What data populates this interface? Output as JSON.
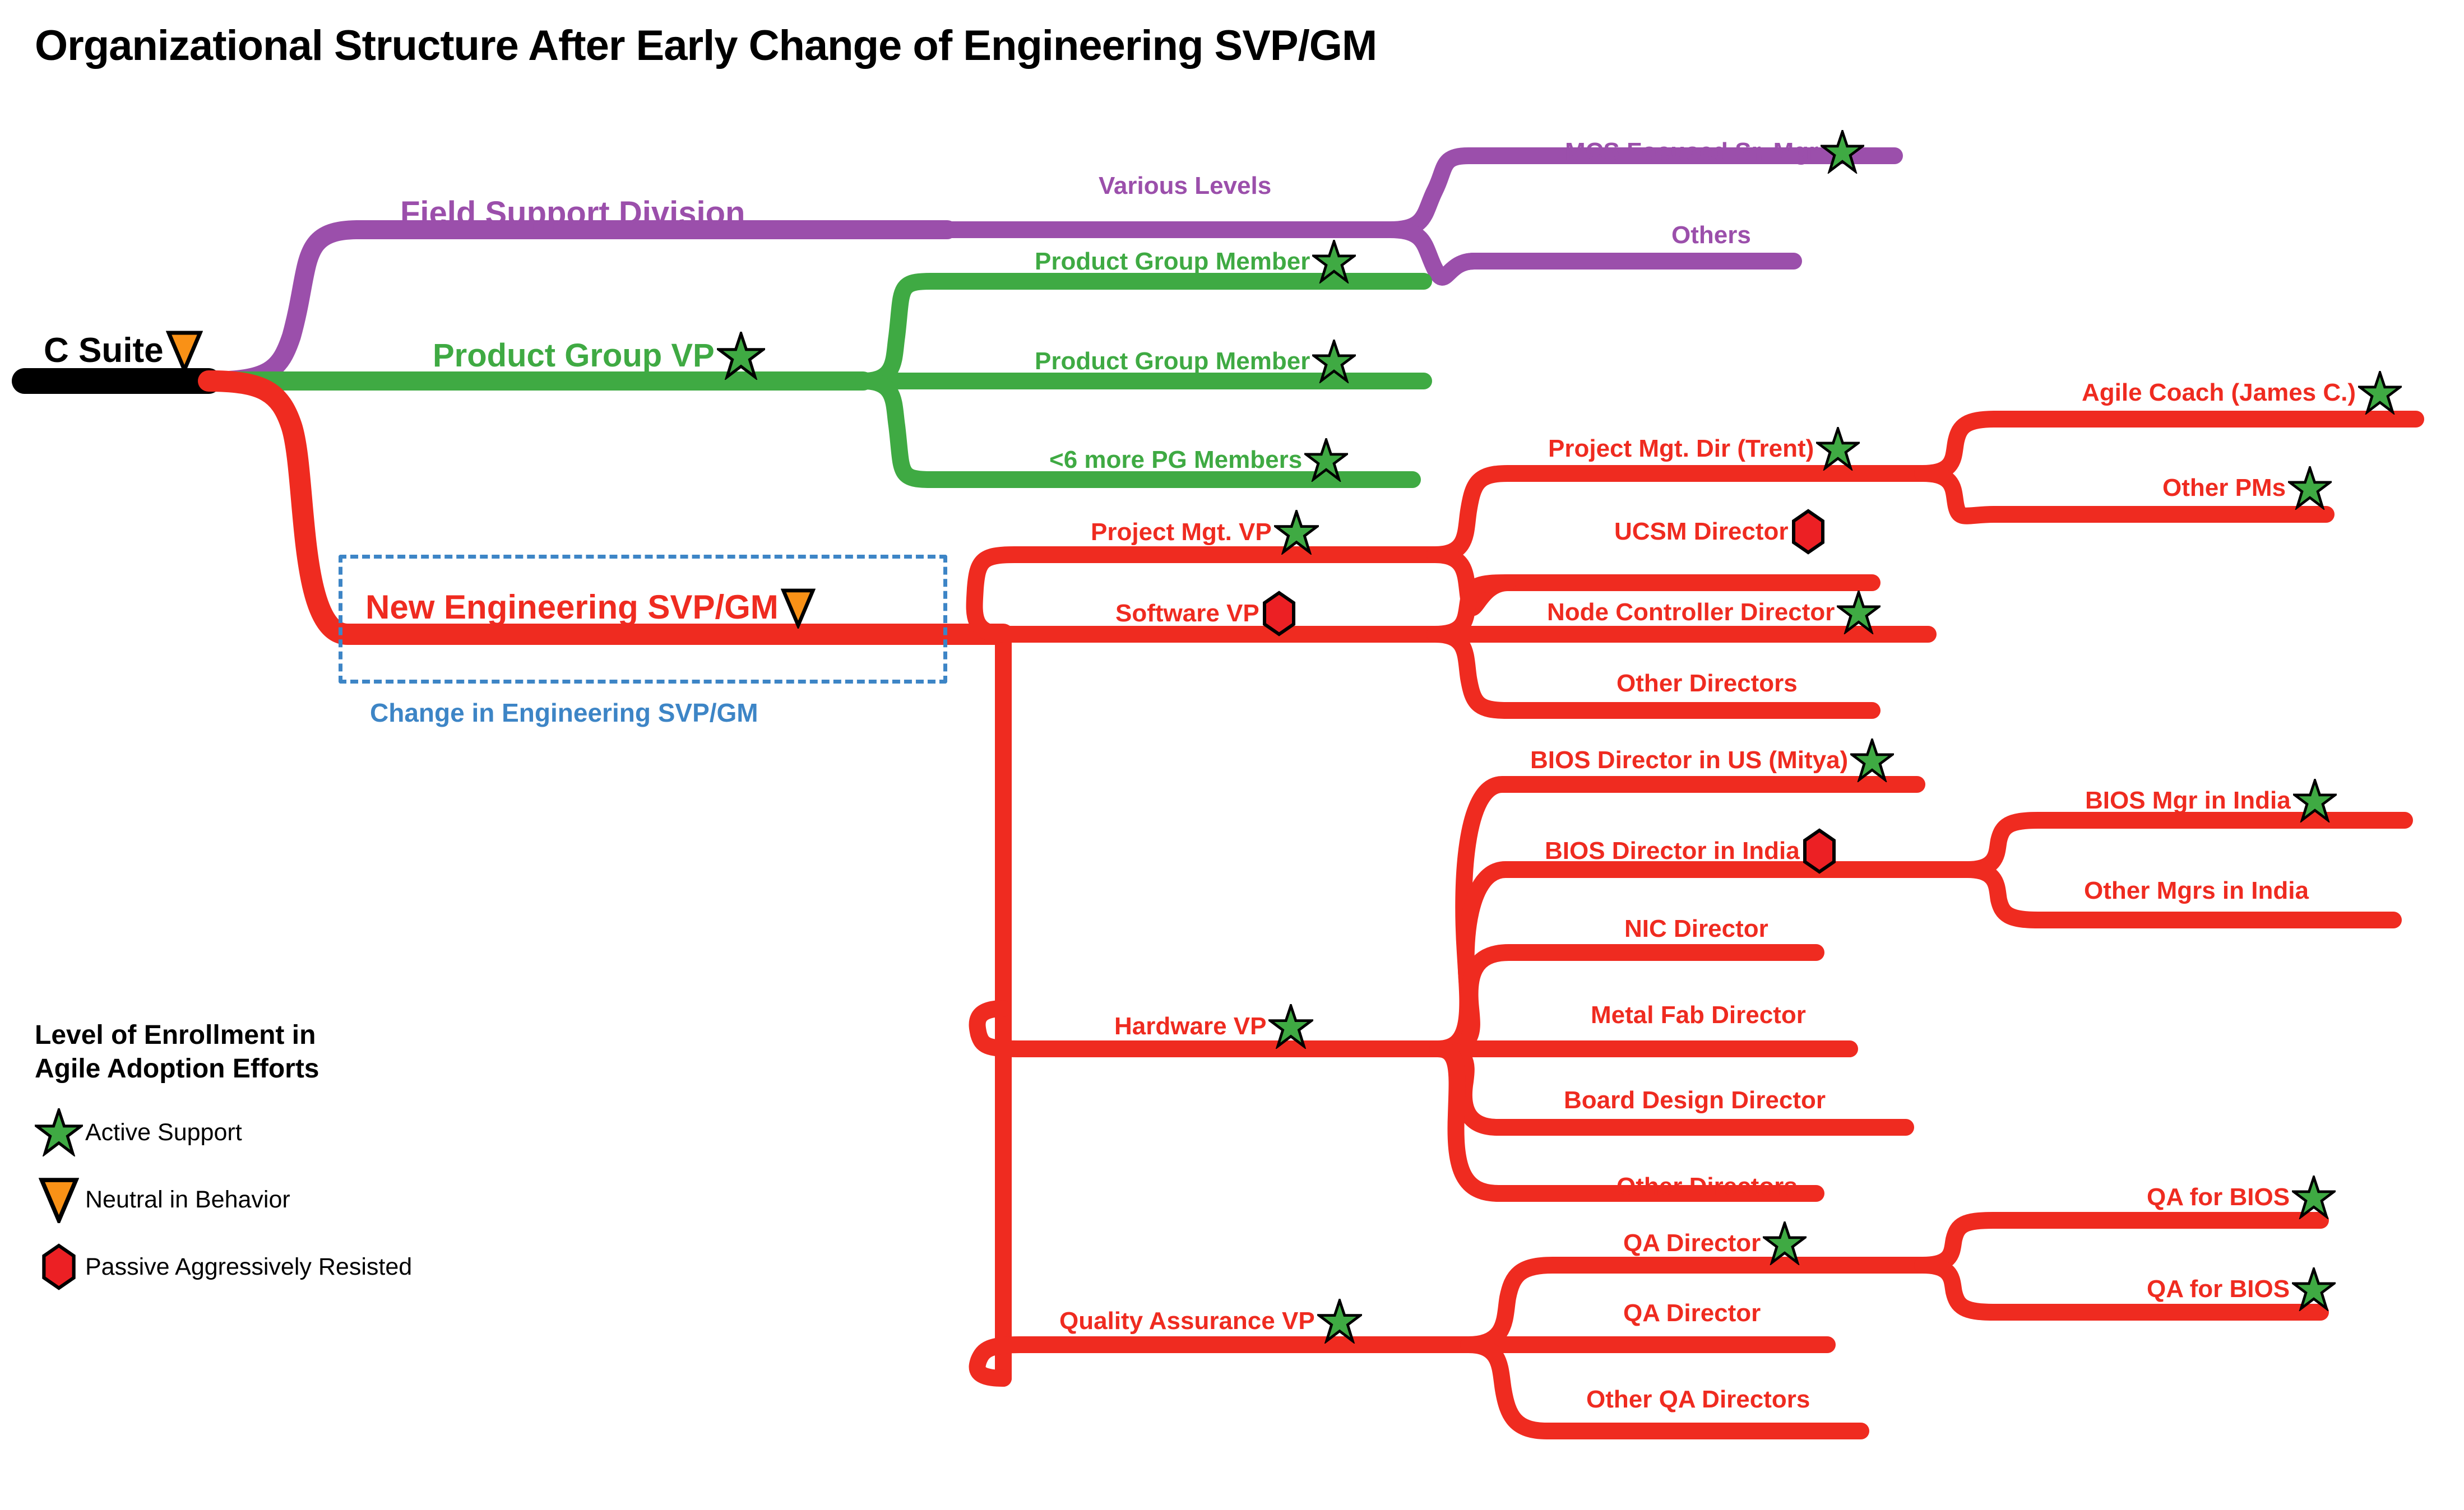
{
  "title": "Organizational Structure After Early Change of Engineering SVP/GM",
  "colors": {
    "root": "#000000",
    "field_support": "#9b4fab",
    "product_group": "#3faa43",
    "engineering": "#ef2b20",
    "annotation": "#3d85c6",
    "active_support": "#3faa43",
    "neutral": "#f99116",
    "resisted": "#ec2024"
  },
  "markers": {
    "star": "star-icon",
    "triangle": "down-triangle-icon",
    "hexagon": "hexagon-icon"
  },
  "root": {
    "label": "C Suite",
    "marker": "triangle"
  },
  "annotation": {
    "label": "Change in Engineering SVP/GM"
  },
  "nodes": {
    "field_support_division": {
      "label": "Field Support Division",
      "marker": "none"
    },
    "various_levels": {
      "label": "Various Levels",
      "marker": "none"
    },
    "mcs_focused_sr_mgr": {
      "label": "MCS Focused Sr. Mgr",
      "marker": "star"
    },
    "others": {
      "label": "Others",
      "marker": "none"
    },
    "product_group_vp": {
      "label": "Product Group VP",
      "marker": "star"
    },
    "pg_member_1": {
      "label": "Product Group Member",
      "marker": "star"
    },
    "pg_member_2": {
      "label": "Product Group Member",
      "marker": "star"
    },
    "pg_more_members": {
      "label": "<6 more PG Members",
      "marker": "star"
    },
    "new_engineering_svp": {
      "label": "New Engineering SVP/GM",
      "marker": "triangle"
    },
    "project_mgt_vp": {
      "label": "Project Mgt. VP",
      "marker": "star"
    },
    "project_mgt_dir": {
      "label": "Project Mgt. Dir (Trent)",
      "marker": "star"
    },
    "agile_coach": {
      "label": "Agile Coach (James C.)",
      "marker": "star"
    },
    "other_pms": {
      "label": "Other PMs",
      "marker": "star"
    },
    "software_vp": {
      "label": "Software VP",
      "marker": "hexagon"
    },
    "ucsm_director": {
      "label": "UCSM Director",
      "marker": "hexagon"
    },
    "node_controller_dir": {
      "label": "Node Controller Director",
      "marker": "star"
    },
    "sw_other_directors": {
      "label": "Other Directors",
      "marker": "none"
    },
    "hardware_vp": {
      "label": "Hardware VP",
      "marker": "star"
    },
    "bios_director_us": {
      "label": "BIOS Director in US (Mitya)",
      "marker": "star"
    },
    "bios_director_india": {
      "label": "BIOS Director in India",
      "marker": "hexagon"
    },
    "bios_mgr_india": {
      "label": "BIOS Mgr in India",
      "marker": "star"
    },
    "other_mgrs_india": {
      "label": "Other Mgrs in India",
      "marker": "none"
    },
    "nic_director": {
      "label": "NIC Director",
      "marker": "none"
    },
    "metal_fab_director": {
      "label": "Metal Fab Director",
      "marker": "none"
    },
    "board_design_director": {
      "label": "Board Design Director",
      "marker": "none"
    },
    "hw_other_directors": {
      "label": "Other Directors",
      "marker": "none"
    },
    "quality_assurance_vp": {
      "label": "Quality Assurance VP",
      "marker": "star"
    },
    "qa_director_1": {
      "label": "QA Director",
      "marker": "star"
    },
    "qa_for_bios_1": {
      "label": "QA for BIOS",
      "marker": "star"
    },
    "qa_for_bios_2": {
      "label": "QA for BIOS",
      "marker": "star"
    },
    "qa_director_2": {
      "label": "QA Director",
      "marker": "none"
    },
    "other_qa_directors": {
      "label": "Other QA Directors",
      "marker": "none"
    }
  },
  "legend": {
    "title_line1": "Level of Enrollment in",
    "title_line2": "Agile Adoption Efforts",
    "items": [
      {
        "marker": "star",
        "label": "Active Support"
      },
      {
        "marker": "triangle",
        "label": "Neutral in Behavior"
      },
      {
        "marker": "hexagon",
        "label": "Passive Aggressively Resisted"
      }
    ]
  }
}
